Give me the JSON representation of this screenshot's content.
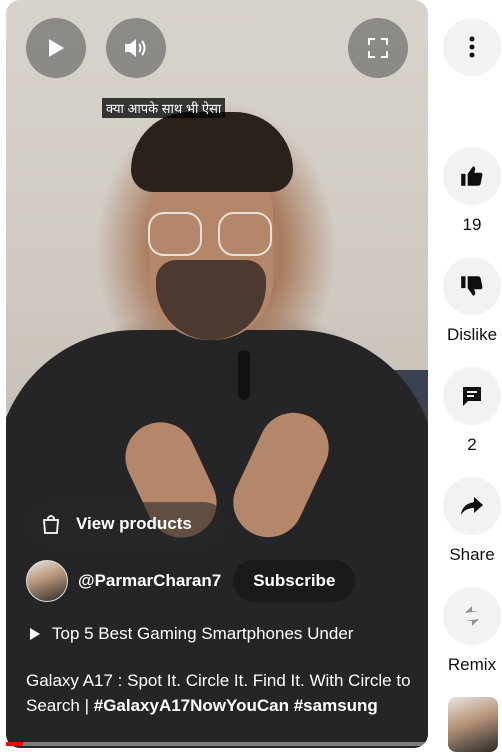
{
  "video": {
    "caption_hindi": "क्या आपके साथ भी ऐसा",
    "view_products_label": "View products",
    "channel_handle": "@ParmarCharan7",
    "subscribe_label": "Subscribe",
    "playlist_title": "Top 5 Best Gaming Smartphones Under",
    "description_plain": "Galaxy A17 : Spot It. Circle It. Find It. With Circle to Search | ",
    "description_tags": "#GalaxyA17NowYouCan #samsung",
    "progress_percent": 4
  },
  "controls": {
    "play_icon": "play-icon",
    "volume_icon": "volume-icon",
    "fullscreen_icon": "fullscreen-icon"
  },
  "actions": {
    "like_count": "19",
    "dislike_label": "Dislike",
    "comment_count": "2",
    "share_label": "Share",
    "remix_label": "Remix"
  },
  "colors": {
    "progress": "#ff0000",
    "rail_button_bg": "#f2f2f2"
  }
}
